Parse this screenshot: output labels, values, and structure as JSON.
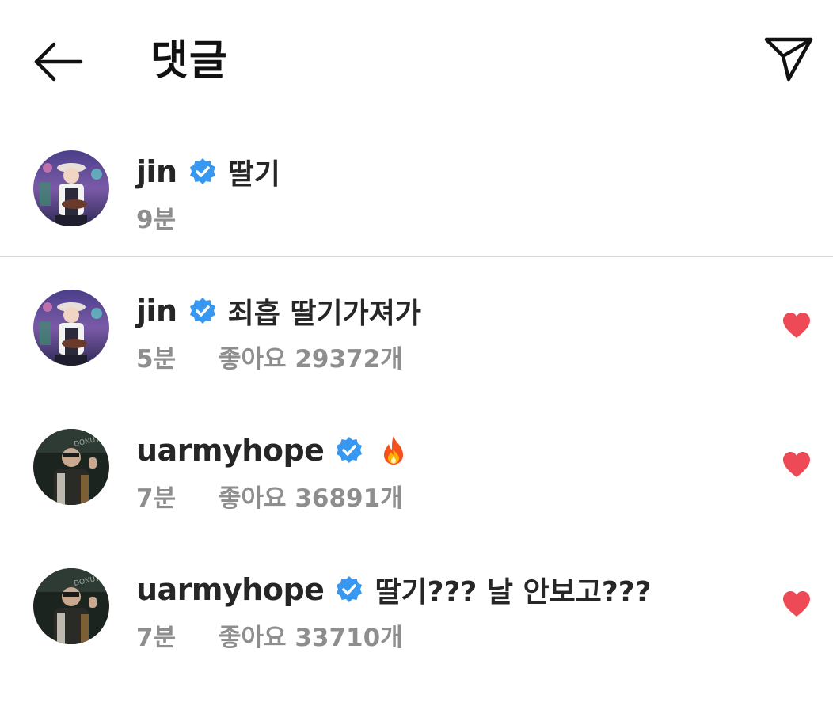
{
  "header": {
    "title": "댓글",
    "back_icon": "arrow-left-icon",
    "share_icon": "paper-plane-icon"
  },
  "colors": {
    "verified": "#3897f0",
    "heart": "#ed4956",
    "meta_text": "#8e8e8e",
    "divider": "#dbdbdb"
  },
  "caption": {
    "username": "jin",
    "verified": true,
    "text": "딸기",
    "time": "9분"
  },
  "comments": [
    {
      "username": "jin",
      "verified": true,
      "text": "죄흡 딸기가져가",
      "time": "5분",
      "likes": "좋아요 29372개",
      "liked": true
    },
    {
      "username": "uarmyhope",
      "verified": true,
      "text": "",
      "emoji": "fire-icon",
      "time": "7분",
      "likes": "좋아요 36891개",
      "liked": true
    },
    {
      "username": "uarmyhope",
      "verified": true,
      "text": "딸기??? 날 안보고???",
      "time": "7분",
      "likes": "좋아요 33710개",
      "liked": true
    }
  ]
}
